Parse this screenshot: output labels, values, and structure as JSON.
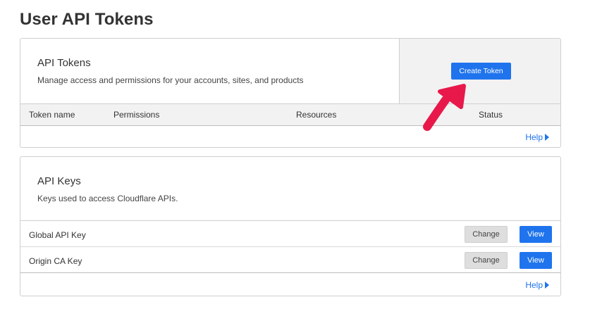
{
  "page": {
    "title": "User API Tokens"
  },
  "tokens": {
    "title": "API Tokens",
    "description": "Manage access and permissions for your accounts, sites, and products",
    "create_button": "Create Token",
    "columns": [
      "Token name",
      "Permissions",
      "Resources",
      "Status"
    ],
    "help": "Help"
  },
  "keys": {
    "title": "API Keys",
    "description": "Keys used to access Cloudflare APIs.",
    "rows": [
      {
        "label": "Global API Key",
        "change": "Change",
        "view": "View"
      },
      {
        "label": "Origin CA Key",
        "change": "Change",
        "view": "View"
      }
    ],
    "help": "Help"
  },
  "colors": {
    "primary": "#1f74ed",
    "annotation_arrow": "#e8184a",
    "panel_bg": "#f2f2f2"
  },
  "icons": {
    "help_caret": "triangle-right-icon",
    "annotation": "hand-drawn-arrow-icon"
  }
}
